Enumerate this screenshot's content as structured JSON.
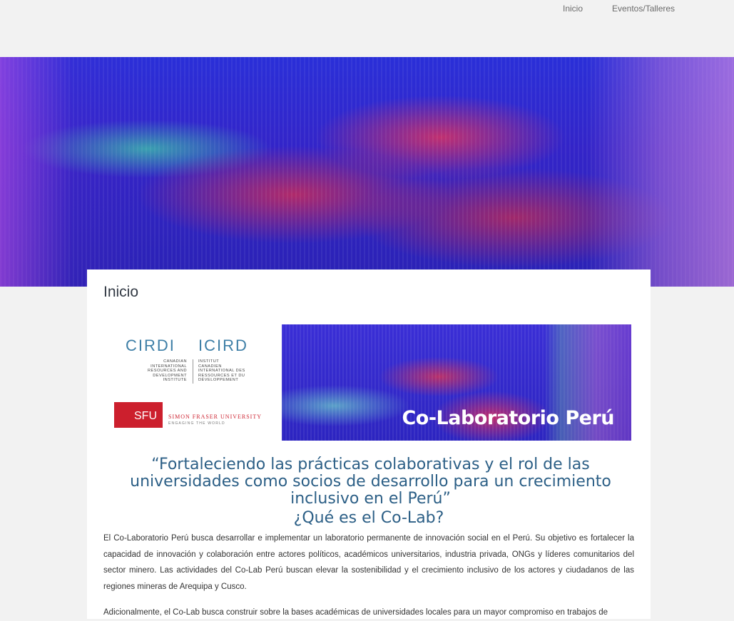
{
  "nav": {
    "items": [
      {
        "label": "Inicio"
      },
      {
        "label": "Eventos/Talleres"
      }
    ]
  },
  "page": {
    "title": "Inicio"
  },
  "logos": {
    "cirdi": {
      "en": "CIRDI",
      "fr": "ICIRD",
      "en_sub": "CANADIAN\nINTERNATIONAL\nRESOURCES AND\nDEVELOPMENT\nINSTITUTE",
      "fr_sub": "INSTITUT\nCANADIEN\nINTERNATIONAL DES\nRESSOURCES ET DU\nDÉVELOPPEMENT"
    },
    "sfu": {
      "abbr": "SFU",
      "name": "SIMON FRASER UNIVERSITY",
      "tagline": "ENGAGING THE WORLD"
    }
  },
  "banner": {
    "title": "Co-Laboratorio Perú"
  },
  "tagline": "“Fortaleciendo las prácticas colaborativas y el rol de las universidades como socios de desarrollo para un crecimiento inclusivo en el Perú”",
  "section": {
    "heading": "¿Qué es el Co-Lab?",
    "paragraphs": [
      "El Co-Laboratorio Perú busca desarrollar e implementar un laboratorio permanente de innovación social en el Perú. Su objetivo es fortalecer la capacidad de innovación y colaboración entre actores políticos, académicos universitarios, industria privada, ONGs y líderes comunitarios del sector minero. Las actividades del Co-Lab Perú buscan elevar la sostenibilidad y el crecimiento inclusivo de los actores y ciudadanos de las regiones mineras de Arequipa y Cusco.",
      "Adicionalmente, el Co-Lab busca construir sobre la bases académicas de universidades locales para un mayor compromiso en trabajos de"
    ]
  }
}
